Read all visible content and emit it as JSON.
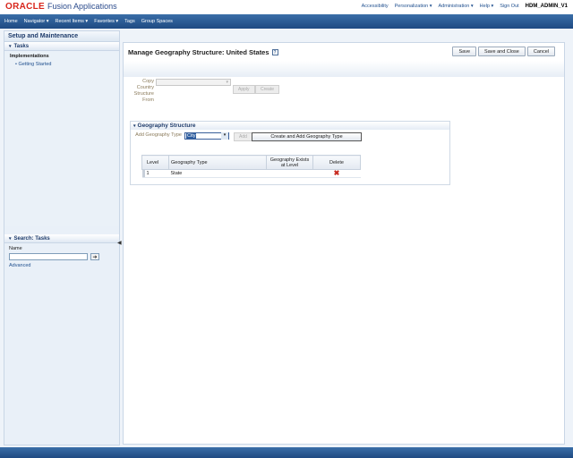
{
  "brand": {
    "oracle": "ORACLE",
    "product": "Fusion Applications"
  },
  "global_nav": [
    "Accessibility",
    "Personalization ▾",
    "Administration ▾",
    "Help ▾",
    "Sign Out"
  ],
  "user": "HDM_ADMIN_V1",
  "nav_bar": [
    "Home",
    "Navigator ▾",
    "Recent Items ▾",
    "Favorites ▾",
    "Tags",
    "Group Spaces"
  ],
  "left_pane": {
    "title": "Setup and Maintenance",
    "tasks_header": "Tasks",
    "implementations_label": "Implementations",
    "getting_started": "Getting Started",
    "search_header": "Search: Tasks",
    "name_label": "Name",
    "advanced": "Advanced"
  },
  "main": {
    "title": "Manage Geography Structure: United States",
    "buttons": {
      "save": "Save",
      "save_close": "Save and Close",
      "cancel": "Cancel"
    },
    "copy_label": "Copy Country Structure From",
    "apply": "Apply",
    "create": "Create",
    "geo_section": {
      "title": "Geography Structure",
      "add_type_label": "Add Geography Type",
      "selected_type": "City",
      "add": "Add",
      "create_and_add": "Create and Add Geography Type",
      "columns": [
        "Level",
        "Geography Type",
        "Geography Exists at Level",
        "Delete"
      ],
      "rows": [
        {
          "level": "1",
          "type": "State",
          "exists": ""
        }
      ]
    }
  },
  "colors": {
    "accent": "#1f4a82",
    "brand_red": "#d8261c"
  }
}
